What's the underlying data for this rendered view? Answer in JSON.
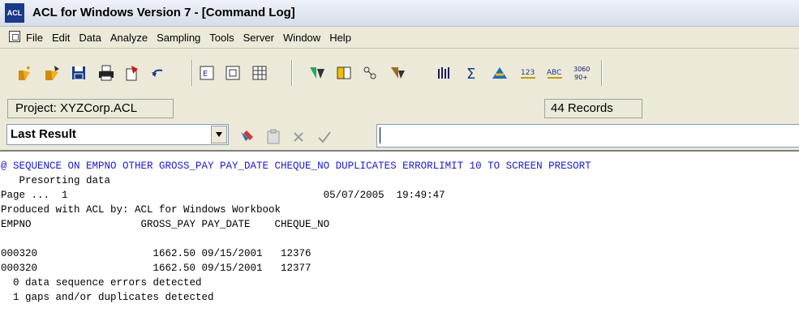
{
  "window": {
    "title": "ACL for Windows Version 7 - [Command Log]",
    "icon_text": "ACL"
  },
  "menu": {
    "items": [
      "File",
      "Edit",
      "Data",
      "Analyze",
      "Sampling",
      "Tools",
      "Server",
      "Window",
      "Help"
    ]
  },
  "toolbar": {
    "icons": [
      "new-project-icon",
      "open-project-icon",
      "save-icon",
      "print-icon",
      "edit-icon",
      "undo-icon",
      "view-icon",
      "overview-icon",
      "table-layout-icon",
      "filter-icon",
      "find-icon",
      "sequence-icon",
      "duplicates-icon",
      "count-icon",
      "total-icon",
      "stratify-icon",
      "histogram-icon",
      "classify-icon",
      "age-icon"
    ]
  },
  "status": {
    "project": "Project: XYZCorp.ACL",
    "records": "44 Records"
  },
  "command_bar": {
    "result_selector": "Last Result",
    "command_text": ""
  },
  "log": {
    "command": "@ SEQUENCE ON EMPNO OTHER GROSS_PAY PAY_DATE CHEQUE_NO DUPLICATES ERRORLIMIT 10 TO SCREEN PRESORT",
    "presort": "   Presorting data",
    "page_line": "Page ...  1                                          05/07/2005  19:49:47",
    "produced": "Produced with ACL by: ACL for Windows Workbook",
    "header": "EMPNO                  GROSS_PAY PAY_DATE    CHEQUE_NO",
    "rows": [
      "000320                   1662.50 09/15/2001   12376",
      "000320                   1662.50 09/15/2001   12377"
    ],
    "summary1": "  0 data sequence errors detected",
    "summary2": "  1 gaps and/or duplicates detected"
  }
}
